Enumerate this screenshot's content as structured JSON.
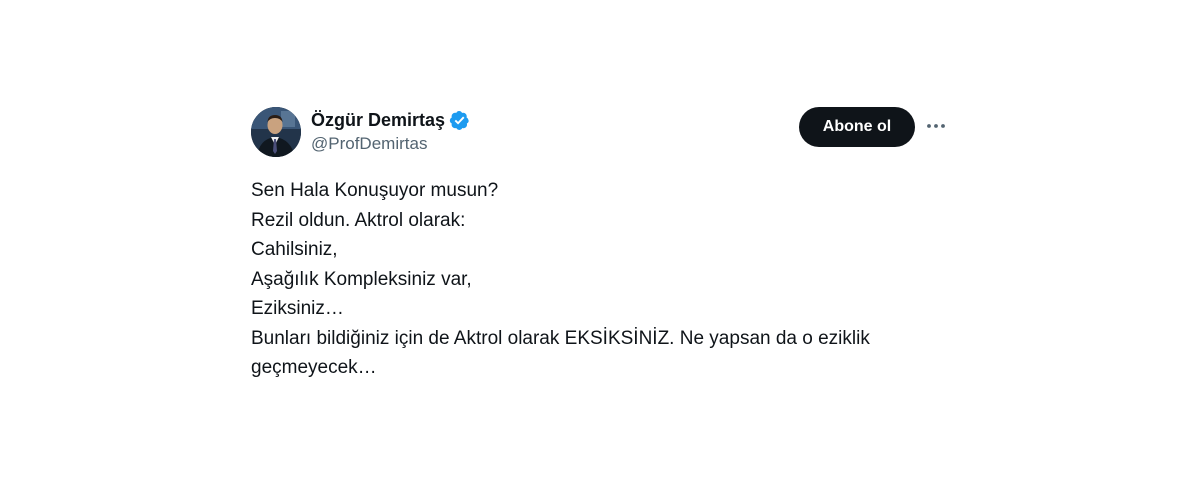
{
  "author": {
    "display_name": "Özgür Demirtaş",
    "handle": "@ProfDemirtas",
    "verified": true
  },
  "actions": {
    "follow_label": "Abone ol",
    "more_icon": "more-horizontal-icon"
  },
  "tweet": {
    "lines": [
      "Sen Hala Konuşuyor musun?",
      "Rezil oldun. Aktrol olarak:",
      "Cahilsiniz,",
      "Aşağılık Kompleksiniz var,",
      "Eziksiniz…",
      "Bunları bildiğiniz için de Aktrol olarak EKSİKSİNİZ. Ne yapsan da o eziklik",
      "geçmeyecek…"
    ]
  },
  "colors": {
    "text": "#0f1419",
    "secondary_text": "#536471",
    "button_bg": "#0f1419",
    "button_text": "#ffffff",
    "verified": "#1d9bf0"
  }
}
